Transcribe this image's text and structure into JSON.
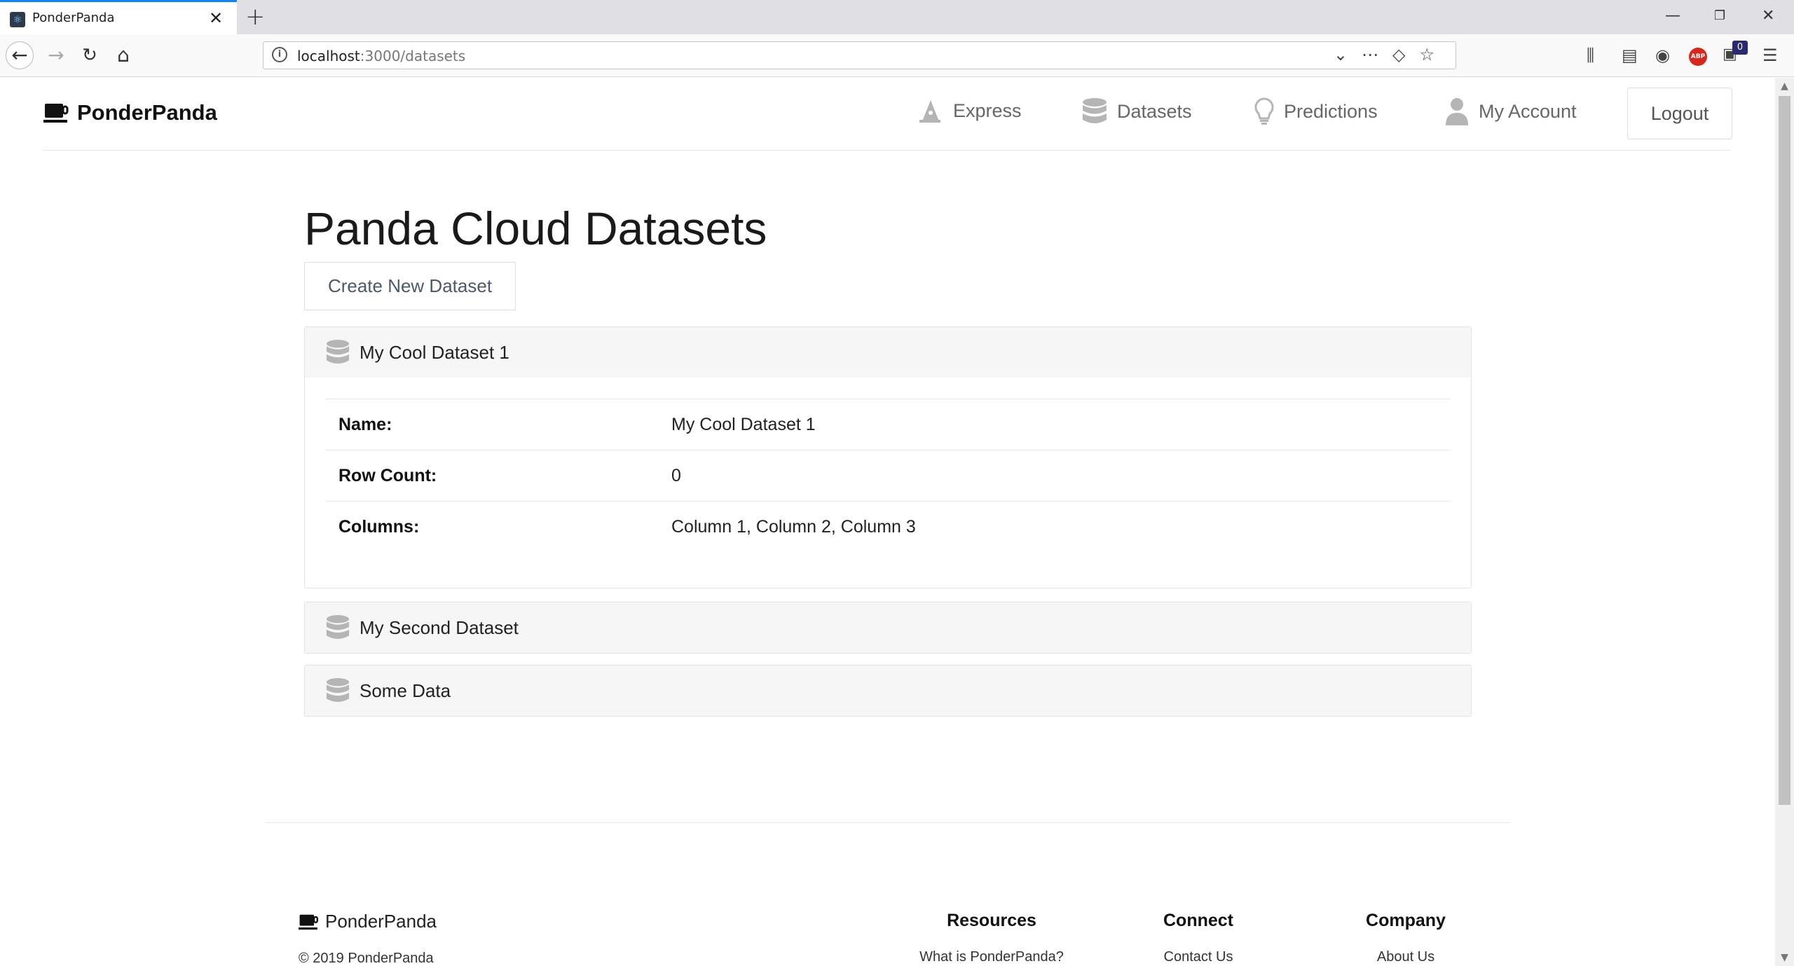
{
  "browser": {
    "tab_title": "PonderPanda",
    "url_host": "localhost",
    "url_path": ":3000/datasets",
    "container_badge": "0",
    "abp_label": "ABP"
  },
  "header": {
    "brand": "PonderPanda",
    "nav": {
      "express": "Express",
      "datasets": "Datasets",
      "predictions": "Predictions",
      "account": "My Account"
    },
    "logout": "Logout"
  },
  "main": {
    "title": "Panda Cloud Datasets",
    "create_button": "Create New Dataset",
    "datasets": [
      {
        "name": "My Cool Dataset 1",
        "expanded": true,
        "details": {
          "name_label": "Name:",
          "name_value": "My Cool Dataset 1",
          "rows_label": "Row Count:",
          "rows_value": "0",
          "columns_label": "Columns:",
          "columns_value": "Column 1, Column 2, Column 3"
        }
      },
      {
        "name": "My Second Dataset",
        "expanded": false
      },
      {
        "name": "Some Data",
        "expanded": false
      }
    ]
  },
  "footer": {
    "brand": "PonderPanda",
    "copyright": "© 2019 PonderPanda",
    "resources": {
      "title": "Resources",
      "link": "What is PonderPanda?"
    },
    "connect": {
      "title": "Connect",
      "link": "Contact Us"
    },
    "company": {
      "title": "Company",
      "link": "About Us"
    }
  },
  "icons": {
    "tab_favicon": "react-icon",
    "express_icon": "pen-nib-icon",
    "datasets_icon": "database-icon",
    "predictions_icon": "lightbulb-icon",
    "account_icon": "user-icon",
    "brand_icon": "coffee-cup-icon"
  },
  "colors": {
    "tab_accent": "#0a84ff",
    "icon_gray": "#b5b5b5",
    "dataset_header_bg": "#f6f6f6"
  }
}
